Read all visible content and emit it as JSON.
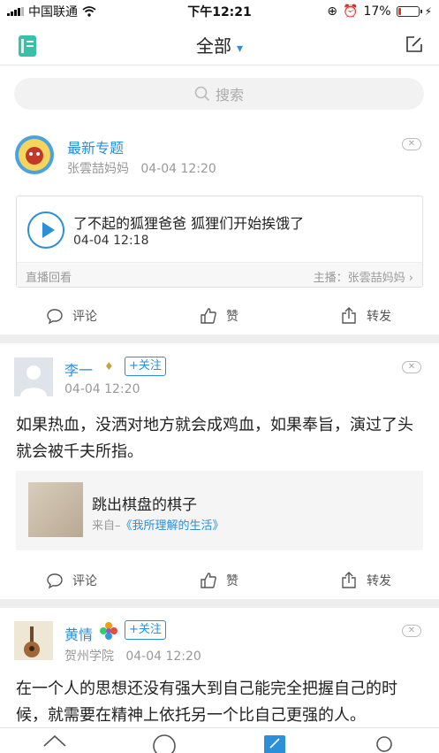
{
  "status": {
    "carrier": "中国联通",
    "time": "下午12:21",
    "battery": "17%",
    "battery_level": 0.17
  },
  "header": {
    "title": "全部",
    "chevron": "chevron-down-icon"
  },
  "search": {
    "placeholder": "搜索"
  },
  "posts": [
    {
      "author": "最新专题",
      "sub_author": "张雲喆妈妈",
      "time": "04-04 12:20",
      "live": {
        "title": "了不起的狐狸爸爸 狐狸们开始挨饿了",
        "time": "04-04 12:18",
        "replay": "直播回看",
        "host": "主播：张雲喆妈妈"
      }
    },
    {
      "author": "李一",
      "follow": "+关注",
      "time": "04-04 12:20",
      "text": "如果热血，没洒对地方就会成鸡血，如果奉旨，演过了头就会被千夫所指。",
      "quote": {
        "title": "跳出棋盘的棋子",
        "from_prefix": "来自–",
        "from_link": "《我所理解的生活》"
      }
    },
    {
      "author": "黄情",
      "follow": "+关注",
      "school": "贺州学院",
      "time": "04-04 12:20",
      "text": "在一个人的思想还没有强大到自己能完全把握自己的时候，就需要在精神上依托另一个比自己更强的人。"
    }
  ],
  "actions": {
    "comment": "评论",
    "like": "赞",
    "share": "转发"
  },
  "colors": {
    "accent": "#2b8fd9",
    "battery_low": "#e0352b"
  }
}
